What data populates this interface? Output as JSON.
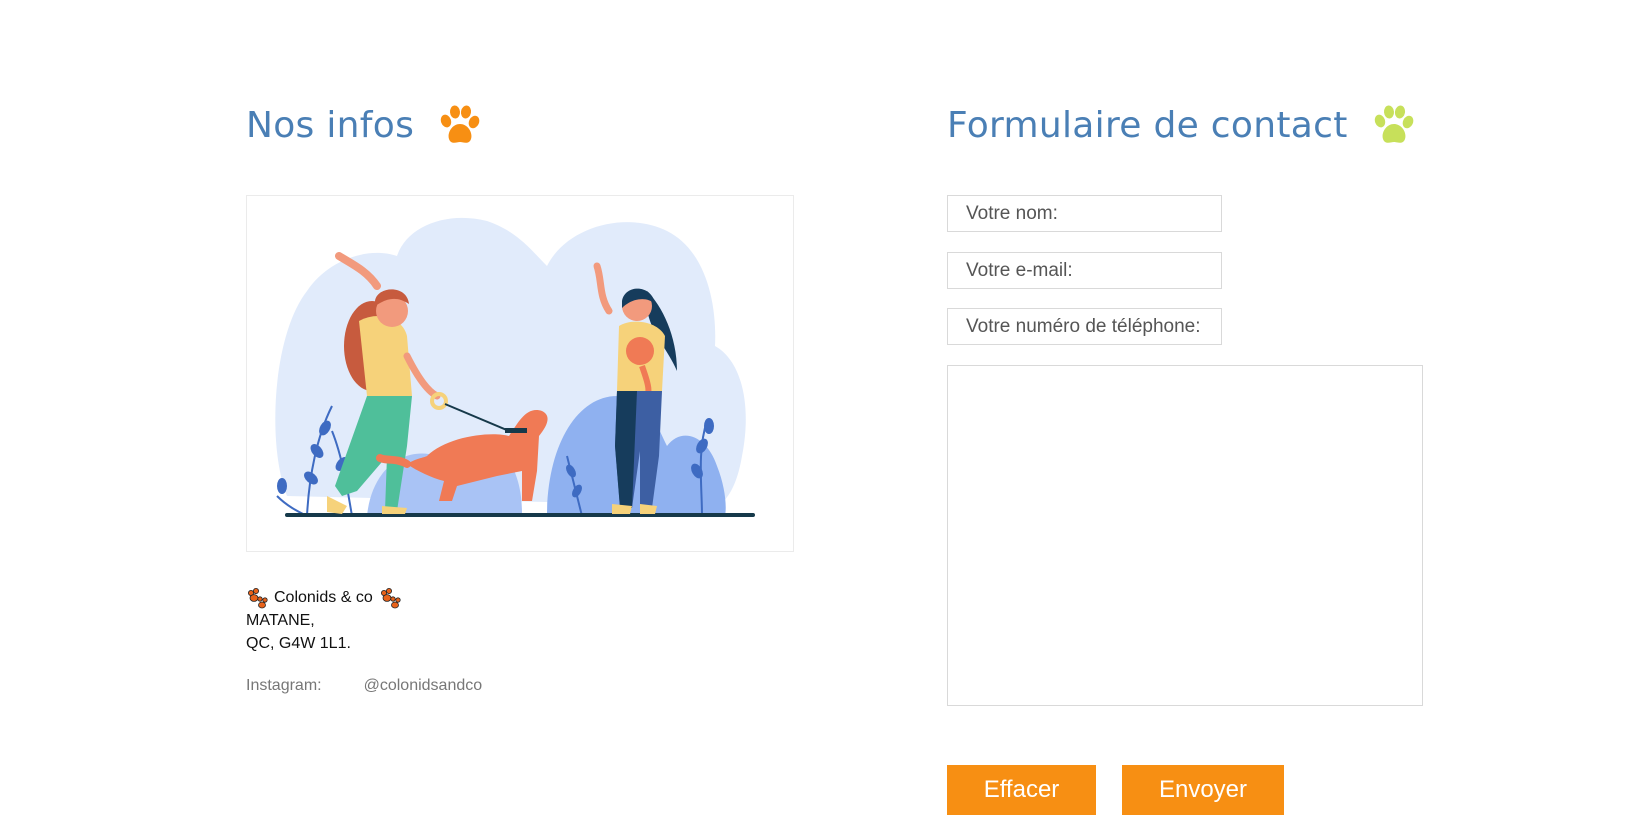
{
  "left": {
    "title": "Nos infos",
    "paw_icon_color": "#f78f13",
    "address": {
      "business_name": "Colonids & co",
      "city": "MATANE,",
      "postal": "QC, G4W 1L1."
    },
    "instagram": {
      "label": "Instagram:",
      "handle": "@colonidsandco"
    }
  },
  "right": {
    "title": "Formulaire de contact",
    "paw_icon_color": "#c7e05a",
    "form": {
      "name_placeholder": "Votre nom:",
      "email_placeholder": "Votre e-mail:",
      "phone_placeholder": "Votre numéro de téléphone:",
      "message_placeholder": "",
      "clear_label": "Effacer",
      "send_label": "Envoyer"
    }
  },
  "colors": {
    "heading": "#4a7fb5",
    "button": "#f78f13"
  }
}
